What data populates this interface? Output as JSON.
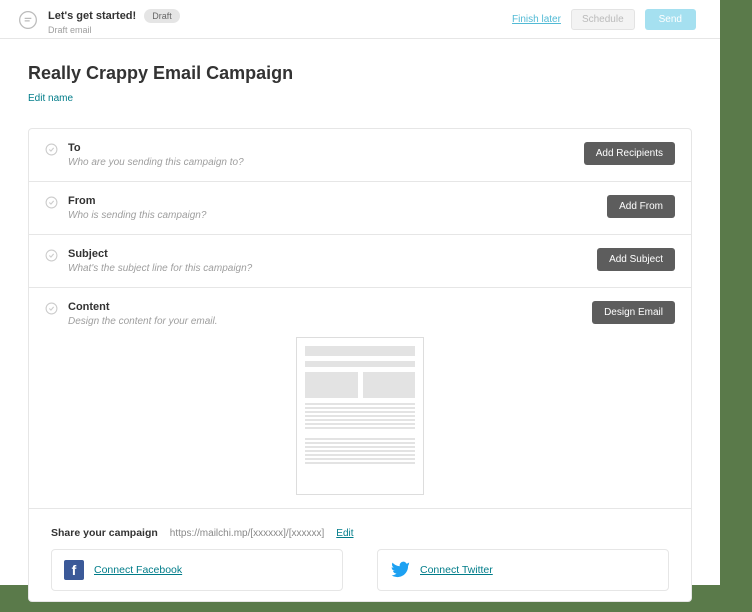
{
  "header": {
    "title": "Let's get started!",
    "badge": "Draft",
    "subtitle": "Draft email",
    "finish_later": "Finish later",
    "schedule": "Schedule",
    "send": "Send"
  },
  "campaign": {
    "title": "Really Crappy Email Campaign",
    "edit_name": "Edit name"
  },
  "sections": {
    "to": {
      "title": "To",
      "help": "Who are you sending this campaign to?",
      "button": "Add Recipients"
    },
    "from": {
      "title": "From",
      "help": "Who is sending this campaign?",
      "button": "Add From"
    },
    "subject": {
      "title": "Subject",
      "help": "What's the subject line for this campaign?",
      "button": "Add Subject"
    },
    "content": {
      "title": "Content",
      "help": "Design the content for your email.",
      "button": "Design Email"
    }
  },
  "share": {
    "label": "Share your campaign",
    "url": "https://mailchi.mp/[xxxxxx]/[xxxxxx]",
    "edit": "Edit",
    "facebook": "Connect Facebook",
    "twitter": "Connect Twitter"
  }
}
